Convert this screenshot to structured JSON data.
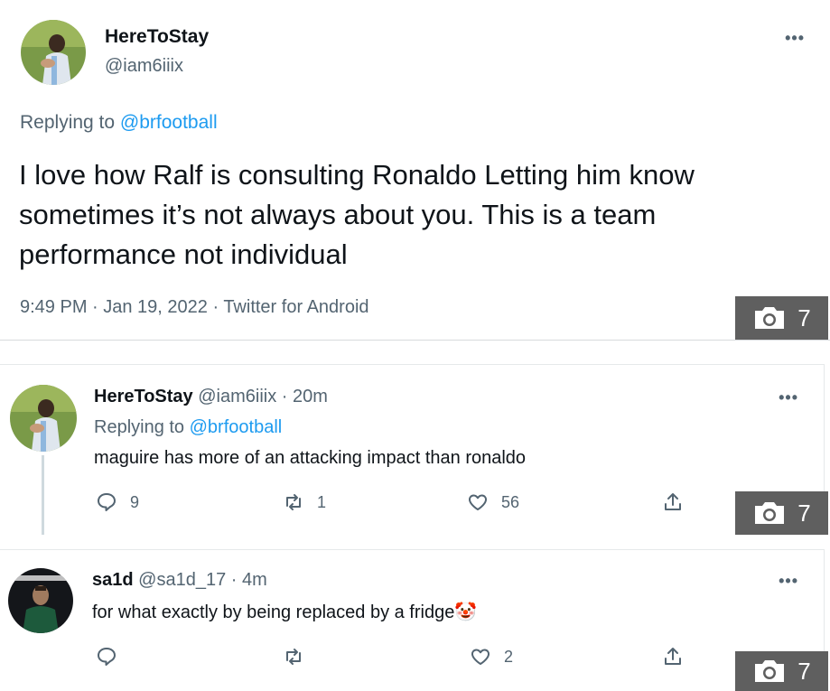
{
  "main_tweet": {
    "display_name": "HereToStay",
    "handle": "@iam6iiix",
    "replying_prefix": "Replying to ",
    "replying_to": "@brfootball",
    "text": "I love how Ralf is consulting Ronaldo Letting him know sometimes it’s not always about you. This is a team performance not individual",
    "meta": "9:49 PM · Jan 19, 2022 · Twitter for Android",
    "more": "•••"
  },
  "reply_1": {
    "display_name": "HereToStay",
    "handle_time": "@iam6iiix · 20m",
    "replying_prefix": "Replying to ",
    "replying_to": "@brfootball",
    "text": "maguire has more of an attacking impact than ronaldo",
    "replies": "9",
    "retweets": "1",
    "likes": "56",
    "more": "•••"
  },
  "reply_2": {
    "display_name": "sa1d",
    "handle_time": "@sa1d_17 · 4m",
    "text": "for what exactly by being replaced by a fridge",
    "emoji": "🤡",
    "replies": "",
    "retweets": "",
    "likes": "2",
    "more": "•••"
  },
  "overlays": {
    "photo_count": "7"
  },
  "colors": {
    "link": "#1d9bf0",
    "muted": "#536471",
    "overlay": "#5f5f5f"
  }
}
